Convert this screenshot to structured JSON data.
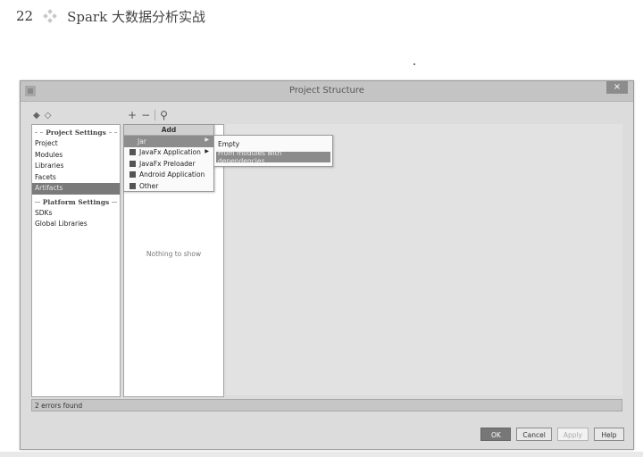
{
  "book": {
    "page_number": "22",
    "title": "Spark 大数据分析实战"
  },
  "window": {
    "title": "Project Structure",
    "close_label": "×"
  },
  "toolbar": {
    "back_icon": "◆",
    "forward_icon": "◇",
    "add_icon": "+",
    "remove_icon": "−",
    "find_icon": "⚲"
  },
  "settings": {
    "project_settings_header": "Project Settings",
    "platform_settings_header": "Platform Settings",
    "project_items": [
      "Project",
      "Modules",
      "Libraries",
      "Facets",
      "Artifacts"
    ],
    "platform_items": [
      "SDKs",
      "Global Libraries"
    ],
    "selected": "Artifacts"
  },
  "artifacts": {
    "empty_message": "Nothing to show"
  },
  "add_menu": {
    "title": "Add",
    "items": [
      {
        "label": "Jar",
        "submenu": true,
        "selected": true
      },
      {
        "label": "JavaFx Application",
        "submenu": true
      },
      {
        "label": "JavaFx Preloader",
        "submenu": false
      },
      {
        "label": "Android Application",
        "submenu": false
      },
      {
        "label": "Other",
        "submenu": false
      }
    ]
  },
  "jar_submenu": {
    "items": [
      "Empty",
      "From modules with dependencies..."
    ]
  },
  "status": {
    "text": "2 errors found"
  },
  "buttons": {
    "ok": "OK",
    "cancel": "Cancel",
    "apply": "Apply",
    "help": "Help"
  }
}
